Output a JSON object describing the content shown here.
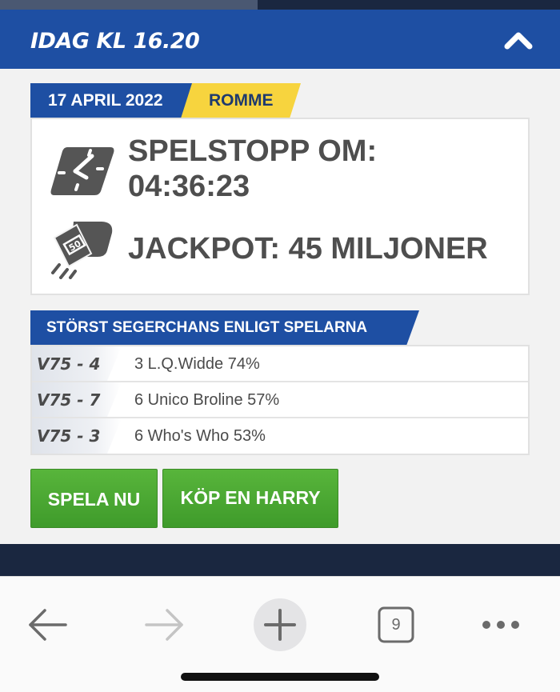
{
  "header": {
    "title": "IDAG KL 16.20",
    "collapse_icon": "chevron-up-icon"
  },
  "race": {
    "date": "17 APRIL 2022",
    "track": "ROMME"
  },
  "info": {
    "spelstopp": "SPELSTOPP OM: 04:36:23",
    "spelstopp_icon": "clock-icon",
    "jackpot": "JACKPOT: 45 MILJONER",
    "jackpot_icon": "money-icon"
  },
  "picks": {
    "title": "STÖRST SEGERCHANS ENLIGT SPELARNA",
    "rows": [
      {
        "race": "V75 - 4",
        "pick": "3 L.Q.Widde 74%"
      },
      {
        "race": "V75 - 7",
        "pick": "6 Unico Broline 57%"
      },
      {
        "race": "V75 - 3",
        "pick": "6 Who's Who 53%"
      }
    ]
  },
  "actions": {
    "play": "SPELA NU",
    "harry": "KÖP EN HARRY"
  },
  "browser": {
    "back_icon": "back-arrow-icon",
    "forward_icon": "forward-arrow-icon",
    "new_tab_icon": "plus-icon",
    "tab_count": "9",
    "menu_icon": "more-dots-icon"
  },
  "colors": {
    "brand_blue": "#1e4fa3",
    "accent_yellow": "#f7d43e",
    "button_green": "#4caa34",
    "dark_navy": "#1a2740"
  }
}
